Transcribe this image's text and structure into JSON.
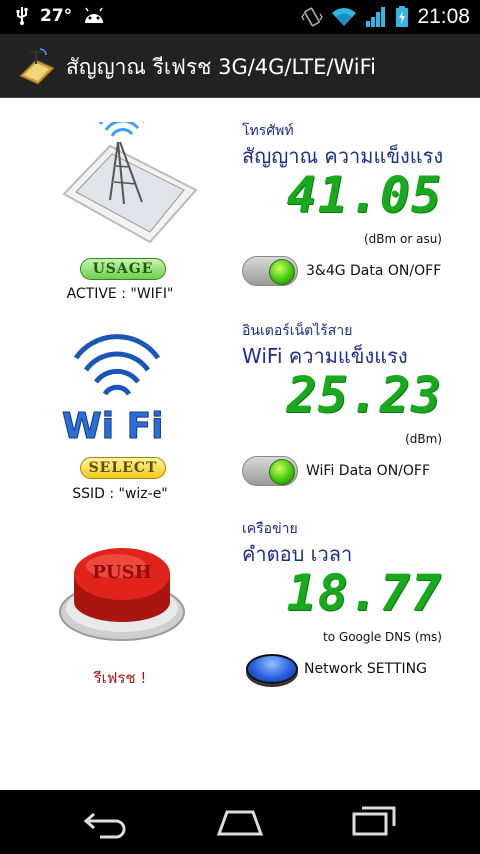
{
  "status_bar": {
    "usb_icon": "usb-icon",
    "temperature": "27°",
    "android_icon": "android-icon",
    "vibrate_icon": "vibrate-icon",
    "wifi_icon": "wifi-icon",
    "signal_icon": "signal-icon",
    "battery_icon": "battery-icon",
    "time": "21:08"
  },
  "action_bar": {
    "title": "สัญญาณ รีเฟรช 3G/4G/LTE/WiFi"
  },
  "cellular": {
    "section_label": "โทรศัพท์",
    "heading": "สัญญาณ ความแข็งแรง",
    "value": "41.05",
    "unit": "(dBm or asu)",
    "usage_badge": "USAGE",
    "active_caption": "ACTIVE : \"WIFI\"",
    "toggle_label": "3&4G Data ON/OFF",
    "toggle_on": true
  },
  "wifi": {
    "section_label": "อินเตอร์เน็ตไร้สาย",
    "heading": "WiFi ความแข็งแรง",
    "value": "25.23",
    "unit": "(dBm)",
    "select_badge": "SELECT",
    "ssid_caption": "SSID : \"wiz-e\"",
    "toggle_label": "WiFi Data ON/OFF",
    "toggle_on": true,
    "logo_text": "Wi Fi"
  },
  "network": {
    "section_label": "เครือข่าย",
    "heading": "คำตอบ เวลา",
    "value": "18.77",
    "unit": "to Google DNS (ms)",
    "push_text": "PUSH",
    "refresh_caption": "รีเฟรช !",
    "button_label": "Network SETTING"
  },
  "colors": {
    "lcd_green": "#19a91c",
    "label_blue": "#1c2f8a",
    "refresh_red": "#b3140f"
  }
}
